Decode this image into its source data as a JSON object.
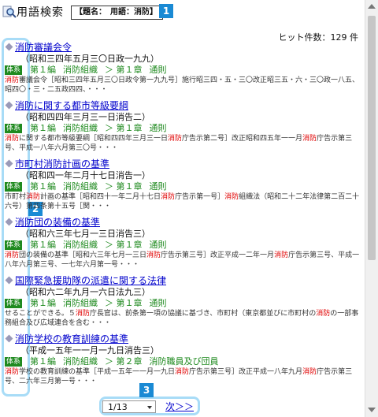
{
  "app_title": "用語検索",
  "query_box": {
    "label": "【題名：　用語：消防】"
  },
  "callouts": [
    "1",
    "2",
    "3"
  ],
  "hit_count": "ヒット件数：129 件",
  "tag_label": "体系",
  "results": [
    {
      "title": "消防審議会令",
      "ref": "（昭和三四年五月三〇日政一九九）",
      "path": [
        "第１編",
        "消防組織",
        "＞ 第１章",
        "通則"
      ],
      "snippet": [
        {
          "t": "消防",
          "hl": true
        },
        {
          "t": "審議会令［昭和三四年五月三〇日政令第一九九号］施行昭三四・五・三〇改正昭三五・六・三〇政一八五、昭四〇・三・二五政四四、・・・",
          "hl": false
        }
      ]
    },
    {
      "title": "消防に関する都市等級要綱",
      "ref": "（昭和四四年三月三一日消告二）",
      "path": [
        "第１編",
        "消防組織",
        "＞ 第１章",
        "通則"
      ],
      "snippet": [
        {
          "t": "消防",
          "hl": true
        },
        {
          "t": "に関する都市等級要綱［昭和四四年三月三一日",
          "hl": false
        },
        {
          "t": "消防",
          "hl": true
        },
        {
          "t": "庁告示第二号］改正昭和四五年一一月",
          "hl": false
        },
        {
          "t": "消防",
          "hl": true
        },
        {
          "t": "庁告示第三号、平成一八年六月第三〇号・・・",
          "hl": false
        }
      ]
    },
    {
      "title": "市町村消防計画の基準",
      "ref": "（昭和四一年二月十七日消告一）",
      "path": [
        "第１編",
        "消防組織",
        "＞ 第１章",
        "通則"
      ],
      "snippet": [
        {
          "t": "市町村",
          "hl": false
        },
        {
          "t": "消防",
          "hl": true
        },
        {
          "t": "計画の基準［昭和四十一年二月十七日",
          "hl": false
        },
        {
          "t": "消防",
          "hl": true
        },
        {
          "t": "庁告示第一号］",
          "hl": false
        },
        {
          "t": "消防",
          "hl": true
        },
        {
          "t": "組織法（昭和二十二年法律第二百二十六号）第四条第十五号［関・・・",
          "hl": false
        }
      ]
    },
    {
      "title": "消防団の装備の基準",
      "ref": "（昭和六三年七月一三日消告三）",
      "path": [
        "第１編",
        "消防組織",
        "＞ 第１章",
        "通則"
      ],
      "snippet": [
        {
          "t": "消防",
          "hl": true
        },
        {
          "t": "団の装備の基準［昭和六三年七月一三日",
          "hl": false
        },
        {
          "t": "消防",
          "hl": true
        },
        {
          "t": "庁告示第三号］改正平成一二年一月",
          "hl": false
        },
        {
          "t": "消防",
          "hl": true
        },
        {
          "t": "庁告示第三号、平成一八年六月第三号、一七年六月第一号・・・",
          "hl": false
        }
      ]
    },
    {
      "title": "国際緊急援助隊の派遣に関する法律",
      "ref": "（昭和六二年九月一六日法九三）",
      "path": [
        "第１編",
        "消防組織",
        "＞ 第１章",
        "通則"
      ],
      "snippet": [
        {
          "t": "せることができる。５",
          "hl": false
        },
        {
          "t": "消防",
          "hl": true
        },
        {
          "t": "庁長官は、前条第一項の協議に基づき、市町村（東京都並びに市町村の",
          "hl": false
        },
        {
          "t": "消防",
          "hl": true
        },
        {
          "t": "の一部事務組合及び広域連合を含む・・・",
          "hl": false
        }
      ]
    },
    {
      "title": "消防学校の教育訓練の基準",
      "ref": "（平成一五年一一月一九日消告三）",
      "path": [
        "第１編",
        "消防組織",
        "＞ 第２章",
        "消防職員及び団員"
      ],
      "snippet": [
        {
          "t": "消防",
          "hl": true
        },
        {
          "t": "学校の教育訓練の基準［平成一五年一一月一九日",
          "hl": false
        },
        {
          "t": "消防",
          "hl": true
        },
        {
          "t": "庁告示第三号］改正平成一八年九月",
          "hl": false
        },
        {
          "t": "消防",
          "hl": true
        },
        {
          "t": "庁告示第三号、二六年三月第一号・・・",
          "hl": false
        }
      ]
    }
  ],
  "pager": {
    "selected": "1/13",
    "next_label": "次＞＞"
  }
}
